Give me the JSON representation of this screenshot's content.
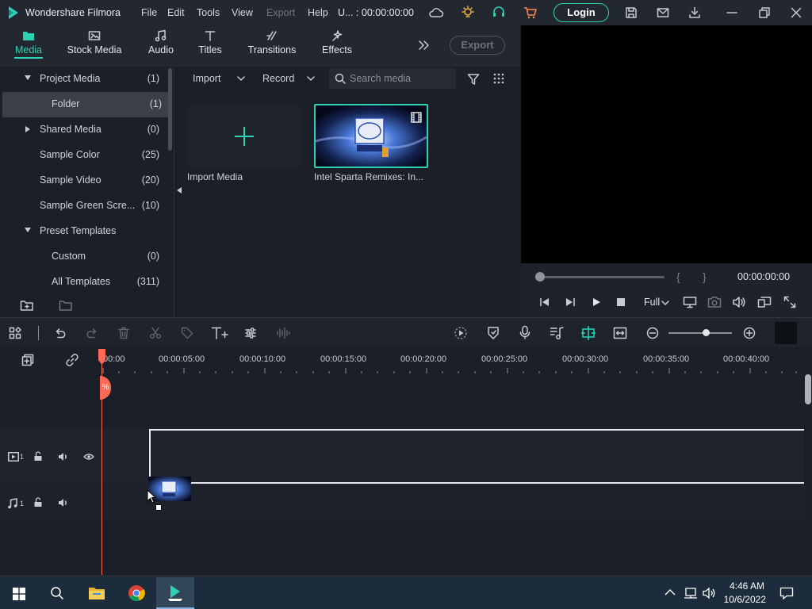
{
  "app": {
    "name": "Wondershare Filmora",
    "project_title": "U... : 00:00:00:00",
    "menu": [
      "File",
      "Edit",
      "Tools",
      "View",
      "Export",
      "Help"
    ],
    "login_label": "Login",
    "accent": "#2fd1b4"
  },
  "media_tabs": [
    {
      "label": "Media",
      "icon": "media-folder-icon",
      "active": true
    },
    {
      "label": "Stock Media",
      "icon": "stock-media-icon"
    },
    {
      "label": "Audio",
      "icon": "music-note-icon"
    },
    {
      "label": "Titles",
      "icon": "title-t-icon"
    },
    {
      "label": "Transitions",
      "icon": "transition-icon"
    },
    {
      "label": "Effects",
      "icon": "effects-icon"
    }
  ],
  "export_label": "Export",
  "tree": [
    {
      "label": "Project Media",
      "count": "(1)",
      "expanded": true
    },
    {
      "label": "Folder",
      "count": "(1)",
      "selected": true
    },
    {
      "label": "Shared Media",
      "count": "(0)",
      "expanded": false
    },
    {
      "label": "Sample Color",
      "count": "(25)"
    },
    {
      "label": "Sample Video",
      "count": "(20)"
    },
    {
      "label": "Sample Green Scre...",
      "count": "(10)"
    },
    {
      "label": "Preset Templates",
      "count": "",
      "expanded": true
    },
    {
      "label": "Custom",
      "count": "(0)"
    },
    {
      "label": "All Templates",
      "count": "(311)"
    }
  ],
  "media_toolbar": {
    "import_label": "Import",
    "record_label": "Record",
    "search_placeholder": "Search media"
  },
  "media_items": {
    "import_label": "Import Media",
    "clip_label": "Intel Sparta Remixes: In..."
  },
  "preview": {
    "timecode": "00:00:00:00",
    "quality": "Full"
  },
  "ruler_labels": [
    "00:00",
    "00:00:05:00",
    "00:00:10:00",
    "00:00:15:00",
    "00:00:20:00",
    "00:00:25:00",
    "00:00:30:00",
    "00:00:35:00",
    "00:00:40:00"
  ],
  "tracks": {
    "video_track_num": "1",
    "audio_track_num": "1"
  },
  "taskbar": {
    "time": "4:46 AM",
    "date": "10/6/2022"
  }
}
